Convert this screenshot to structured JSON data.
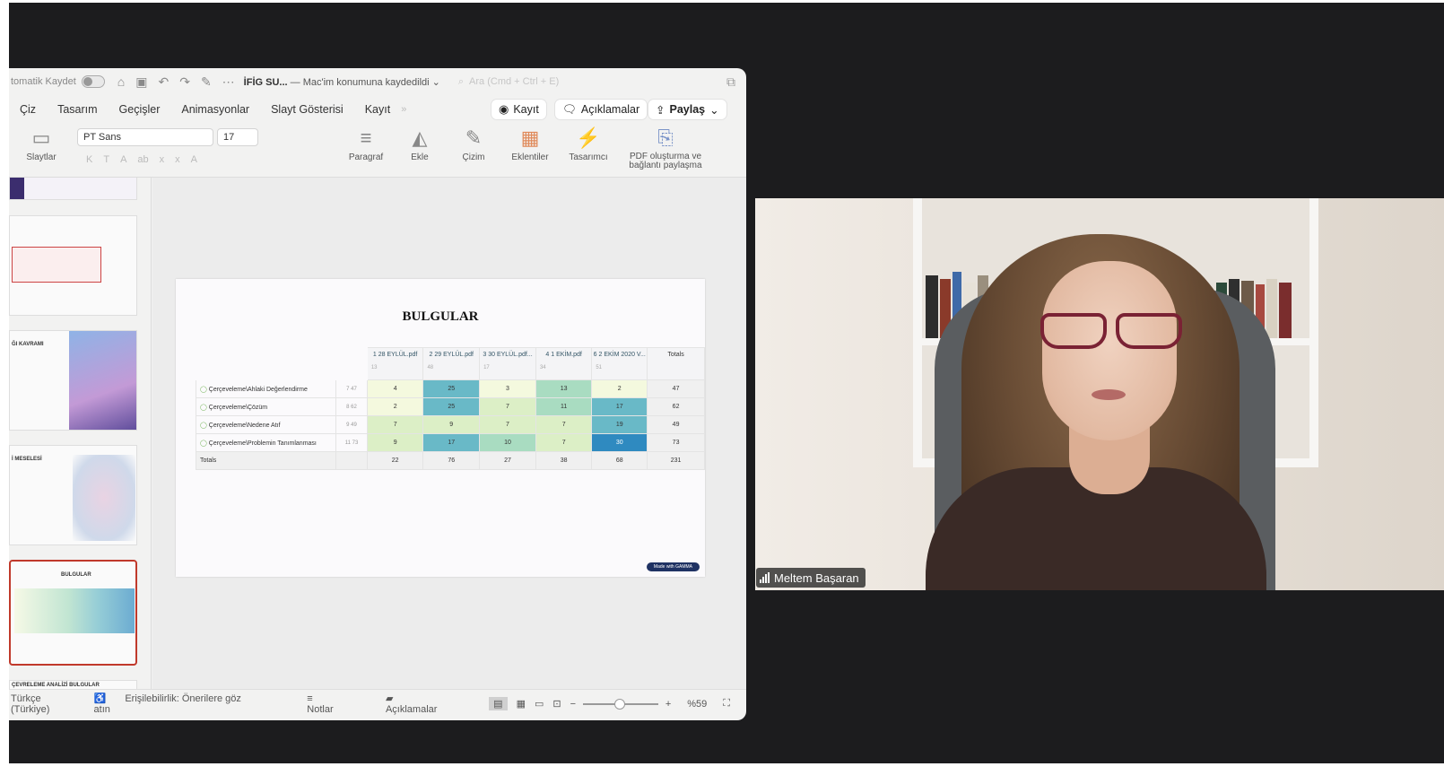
{
  "window": {
    "autosave_label": "tomatik Kaydet",
    "doc_name": "İFİG SU...",
    "doc_status": "— Mac'im konumuna kaydedildi",
    "search_placeholder": "Ara (Cmd + Ctrl + E)"
  },
  "menu": {
    "items": [
      "Çiz",
      "Tasarım",
      "Geçişler",
      "Animasyonlar",
      "Slayt Gösterisi",
      "Kayıt"
    ],
    "overflow": "»",
    "record_button": "Kayıt",
    "comments_button": "Açıklamalar",
    "share_button": "Paylaş"
  },
  "ribbon": {
    "slides_label": "Slaytlar",
    "font_name": "PT Sans",
    "font_size": "17",
    "paragraph_label": "Paragraf",
    "insert_label": "Ekle",
    "draw_label": "Çizim",
    "addins_label": "Eklentiler",
    "designer_label": "Tasarımcı",
    "pdf_label_1": "PDF oluşturma ve",
    "pdf_label_2": "bağlantı paylaşma"
  },
  "thumbnails": {
    "slide3_title": "ĞI KAVRAMI",
    "slide4_title": "İ MESELESİ",
    "slide5_title": "BULGULAR",
    "slide6_title": "ÇEVRELEME ANALİZİ BULGULAR"
  },
  "slide": {
    "title": "BULGULAR",
    "badge": "Made with GAMMA",
    "columns": [
      {
        "name": "1 28 EYLÜL.pdf",
        "count": "13"
      },
      {
        "name": "2 29 EYLÜL.pdf",
        "count": "48"
      },
      {
        "name": "3 30 EYLÜL.pdf...",
        "count": "17"
      },
      {
        "name": "4 1 EKİM.pdf",
        "count": "34"
      },
      {
        "name": "6 2 EKİM 2020 V...",
        "count": "51"
      }
    ],
    "totals_header": "Totals",
    "rows": [
      {
        "name": "Çerçeveleme\\Ahlaki Değerlendirme",
        "meta": "7  47",
        "values": [
          "4",
          "25",
          "3",
          "13",
          "2"
        ],
        "total": "47"
      },
      {
        "name": "Çerçeveleme\\Çözüm",
        "meta": "8  62",
        "values": [
          "2",
          "25",
          "7",
          "11",
          "17"
        ],
        "total": "62"
      },
      {
        "name": "Çerçeveleme\\Nedene Atıf",
        "meta": "9  49",
        "values": [
          "7",
          "9",
          "7",
          "7",
          "19"
        ],
        "total": "49"
      },
      {
        "name": "Çerçeveleme\\Problemin Tanımlanması",
        "meta": "11  73",
        "values": [
          "9",
          "17",
          "10",
          "7",
          "30"
        ],
        "total": "73"
      }
    ],
    "totals_row": {
      "label": "Totals",
      "values": [
        "22",
        "76",
        "27",
        "38",
        "68"
      ],
      "total": "231"
    },
    "heat_colors": {
      "low": "#f4f9de",
      "mid_low": "#dcefc6",
      "mid": "#a9dcc1",
      "high": "#69b9c7",
      "max": "#2f8ac0"
    }
  },
  "statusbar": {
    "language": "Türkçe (Türkiye)",
    "accessibility": "Erişilebilirlik: Önerilere göz atın",
    "notes": "Notlar",
    "comments": "Açıklamalar",
    "zoom_minus": "−",
    "zoom_plus": "+",
    "zoom_level": "%59",
    "zoom_fraction": 0.59
  },
  "participant": {
    "name": "Meltem Başaran"
  }
}
